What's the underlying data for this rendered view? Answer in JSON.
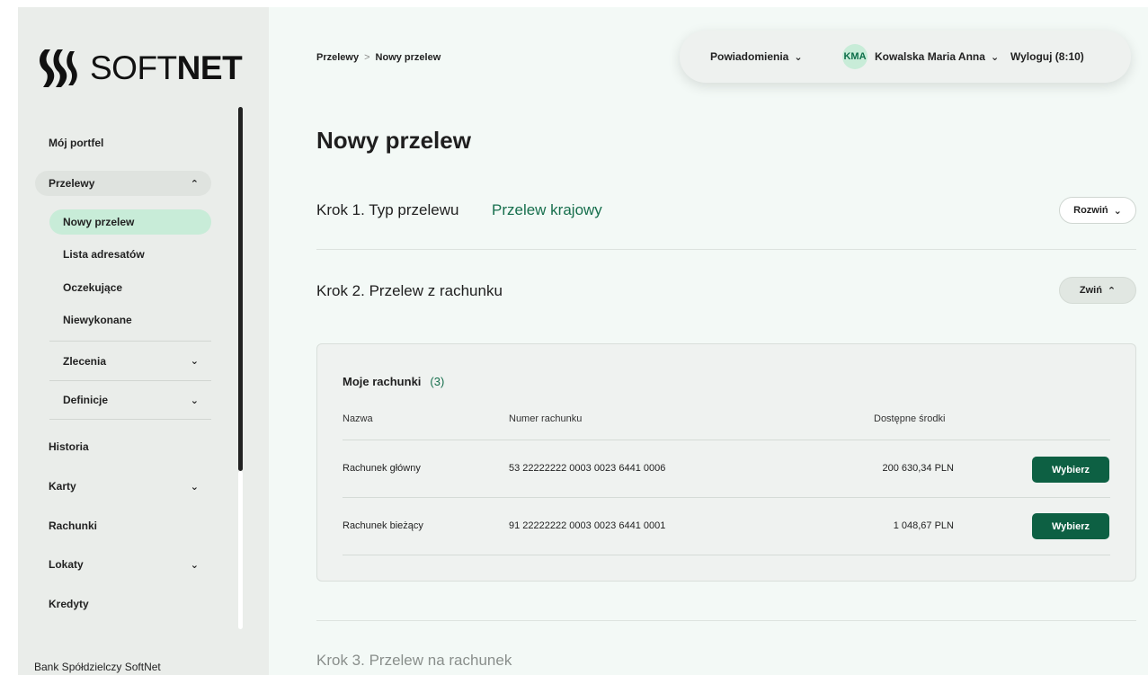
{
  "brand": {
    "logo_text_thin": "SOFT",
    "logo_text_bold": "NET",
    "accent": "#176f4d",
    "button_color": "#0d6043"
  },
  "sidebar": {
    "items": {
      "portfel": "Mój portfel",
      "przelewy": "Przelewy",
      "nowy_przelew": "Nowy przelew",
      "lista_adresatow": "Lista adresatów",
      "oczekujace": "Oczekujące",
      "niewykonane": "Niewykonane",
      "zlecenia": "Zlecenia",
      "definicje": "Definicje",
      "historia": "Historia",
      "karty": "Karty",
      "rachunki": "Rachunki",
      "lokaty": "Lokaty",
      "kredyty": "Kredyty"
    },
    "bank_name": "Bank Spółdzielczy SoftNet"
  },
  "breadcrumb": {
    "parent": "Przelewy",
    "separator": ">",
    "current": "Nowy przelew"
  },
  "topbar": {
    "notifications": "Powiadomienia",
    "avatar_initials": "KMA",
    "user_name": "Kowalska Maria Anna",
    "logout": "Wyloguj (8:10)"
  },
  "page": {
    "title": "Nowy przelew"
  },
  "steps": {
    "step1": {
      "label": "Krok 1. Typ przelewu",
      "value": "Przelew krajowy",
      "button": "Rozwiń"
    },
    "step2": {
      "label": "Krok 2. Przelew z rachunku",
      "button": "Zwiń"
    },
    "step3": {
      "label": "Krok 3. Przelew na rachunek"
    }
  },
  "accounts": {
    "title": "Moje rachunki",
    "count": "(3)",
    "columns": {
      "name": "Nazwa",
      "number": "Numer rachunku",
      "funds": "Dostępne środki"
    },
    "rows": [
      {
        "name": "Rachunek główny",
        "number": "53 22222222 0003 0023 6441 0006",
        "funds": "200 630,34 PLN",
        "action": "Wybierz"
      },
      {
        "name": "Rachunek bieżący",
        "number": "91 22222222 0003 0023 6441 0001",
        "funds": "1 048,67 PLN",
        "action": "Wybierz"
      }
    ]
  }
}
